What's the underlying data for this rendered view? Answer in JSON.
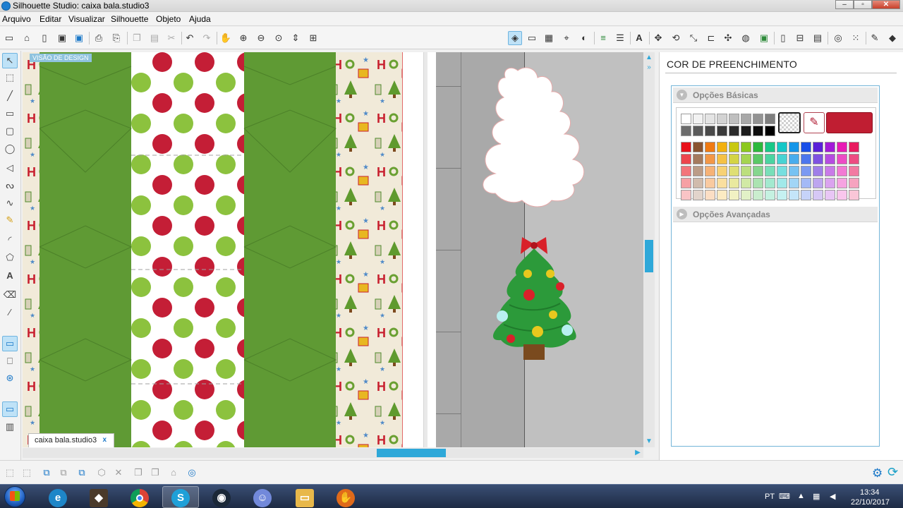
{
  "window": {
    "title": "Silhouette Studio: caixa bala.studio3"
  },
  "menu": [
    "Arquivo",
    "Editar",
    "Visualizar",
    "Silhouette",
    "Objeto",
    "Ajuda"
  ],
  "canvas": {
    "design_view_label": "VISÃO DE DESIGN",
    "tab_label": "caixa bala.studio3",
    "tab_close": "x"
  },
  "panel": {
    "title": "COR DE PREENCHIMENTO",
    "basic_options": "Opções Básicas",
    "advanced_options": "Opções Avançadas",
    "current_color": "#c01e32"
  },
  "palette": {
    "greys": [
      "#ffffff",
      "#f2f2f2",
      "#e4e4e4",
      "#d3d3d3",
      "#bfbfbf",
      "#a8a8a8",
      "#939393",
      "#7f7f7f",
      "#6c6c6c",
      "#5a5a5a",
      "#494949",
      "#3a3a3a",
      "#2b2b2b",
      "#1c1c1c",
      "#0d0d0d",
      "#000000"
    ],
    "hues": [
      "#e8111b",
      "#8a5430",
      "#f07a12",
      "#f2b010",
      "#c8c810",
      "#8cc81e",
      "#2cb83c",
      "#18c887",
      "#15c7c7",
      "#1495e8",
      "#1a4fe8",
      "#5a21d8",
      "#a21ad8",
      "#e81ab5",
      "#e81a5f"
    ],
    "tints": [
      0,
      0.22,
      0.42,
      0.6,
      0.75
    ]
  },
  "taskbar": {
    "lang": "PT",
    "time": "13:34",
    "date": "22/10/2017"
  }
}
